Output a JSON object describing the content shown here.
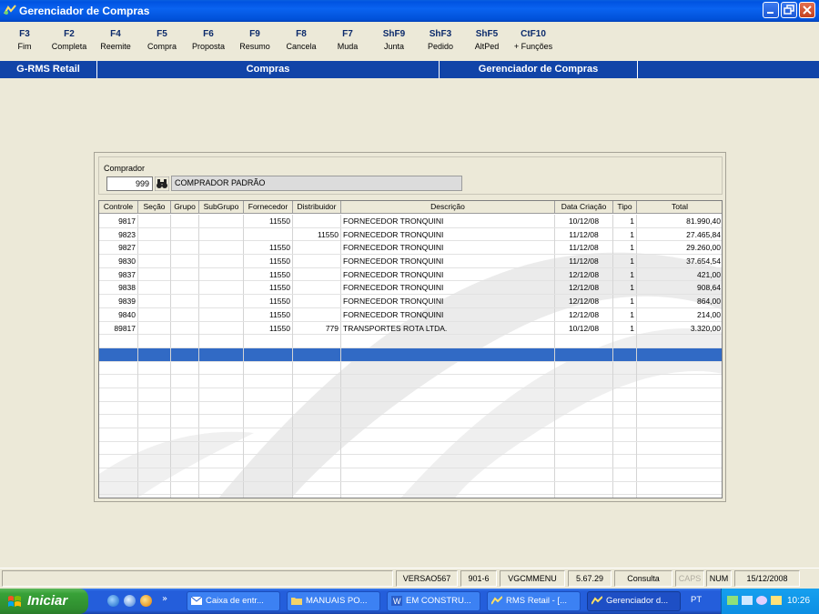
{
  "window": {
    "title": "Gerenciador de Compras"
  },
  "fkeys": [
    {
      "key": "F3",
      "label": "Fim"
    },
    {
      "key": "F2",
      "label": "Completa"
    },
    {
      "key": "F4",
      "label": "Reemite"
    },
    {
      "key": "F5",
      "label": "Compra"
    },
    {
      "key": "F6",
      "label": "Proposta"
    },
    {
      "key": "F9",
      "label": "Resumo"
    },
    {
      "key": "F8",
      "label": "Cancela"
    },
    {
      "key": "F7",
      "label": "Muda"
    },
    {
      "key": "ShF9",
      "label": "Junta"
    },
    {
      "key": "ShF3",
      "label": "Pedido"
    },
    {
      "key": "ShF5",
      "label": "AltPed"
    },
    {
      "key": "CtF10",
      "label": "+ Funções"
    }
  ],
  "module_bar": {
    "system": "G-RMS Retail",
    "module": "Compras",
    "screen": "Gerenciador de Compras"
  },
  "comprador": {
    "label": "Comprador",
    "code": "999",
    "name": "COMPRADOR PADRÃO"
  },
  "grid": {
    "headers": [
      "Controle",
      "Seção",
      "Grupo",
      "SubGrupo",
      "Fornecedor",
      "Distribuidor",
      "Descrição",
      "Data Criação",
      "Tipo",
      "Total"
    ],
    "rows": [
      [
        "9817",
        "",
        "",
        "",
        "11550",
        "",
        "FORNECEDOR TRONQUINI",
        "10/12/08",
        "1",
        "81.990,40"
      ],
      [
        "9823",
        "",
        "",
        "",
        "",
        "11550",
        "FORNECEDOR TRONQUINI",
        "11/12/08",
        "1",
        "27.465,84"
      ],
      [
        "9827",
        "",
        "",
        "",
        "11550",
        "",
        "FORNECEDOR TRONQUINI",
        "11/12/08",
        "1",
        "29.260,00"
      ],
      [
        "9830",
        "",
        "",
        "",
        "11550",
        "",
        "FORNECEDOR TRONQUINI",
        "11/12/08",
        "1",
        "37.654,54"
      ],
      [
        "9837",
        "",
        "",
        "",
        "11550",
        "",
        "FORNECEDOR TRONQUINI",
        "12/12/08",
        "1",
        "421,00"
      ],
      [
        "9838",
        "",
        "",
        "",
        "11550",
        "",
        "FORNECEDOR TRONQUINI",
        "12/12/08",
        "1",
        "908,64"
      ],
      [
        "9839",
        "",
        "",
        "",
        "11550",
        "",
        "FORNECEDOR TRONQUINI",
        "12/12/08",
        "1",
        "864,00"
      ],
      [
        "9840",
        "",
        "",
        "",
        "11550",
        "",
        "FORNECEDOR TRONQUINI",
        "12/12/08",
        "1",
        "214,00"
      ],
      [
        "89817",
        "",
        "",
        "",
        "11550",
        "779",
        "TRANSPORTES ROTA LTDA.",
        "10/12/08",
        "1",
        "3.320,00"
      ]
    ],
    "empty_rows": 13,
    "selected_empty_row": 1
  },
  "statusbar": {
    "version": "VERSAO567",
    "code": "901-6",
    "menu": "VGCMMENU",
    "build": "5.67.29",
    "mode": "Consulta",
    "caps": "CAPS",
    "num": "NUM",
    "date": "15/12/2008"
  },
  "taskbar": {
    "start_label": "Iniciar",
    "tasks": [
      {
        "label": "Caixa de entr...",
        "icon": "outlook-icon"
      },
      {
        "label": "MANUAIS PO...",
        "icon": "folder-icon"
      },
      {
        "label": "EM CONSTRU...",
        "icon": "word-icon"
      },
      {
        "label": "RMS Retail - [...",
        "icon": "rms-icon"
      },
      {
        "label": "Gerenciador d...",
        "icon": "rms-icon"
      }
    ],
    "language": "PT",
    "clock": "10:26"
  },
  "colors": {
    "module_bar": "#1144a8",
    "selection": "#316ac5",
    "start_button": "#38a138",
    "taskbar": "#245edb"
  }
}
